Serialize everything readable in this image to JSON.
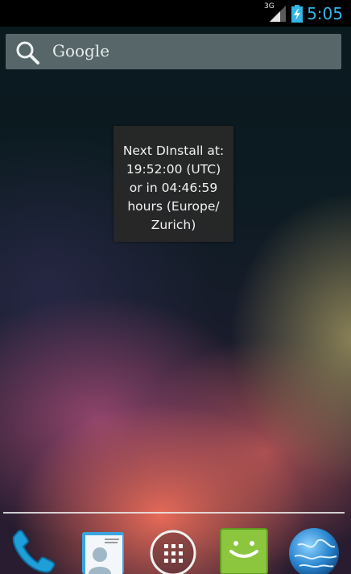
{
  "status_bar": {
    "network_type": "3G",
    "clock": "5:05",
    "icons": [
      "signal-icon",
      "battery-charging-icon"
    ],
    "accent_color": "#33b5e5"
  },
  "search": {
    "label": "Google",
    "icon": "search-icon"
  },
  "widget": {
    "text": "Next DInstall at: 19:52:00 (UTC) or in 04:46:59 hours (Europe/ Zurich)",
    "lines": [
      "Next DInstall at:",
      "19:52:00 (UTC)",
      "or in 04:46:59",
      "hours (Europe/",
      "Zurich)"
    ]
  },
  "dock": {
    "items": [
      {
        "icon": "phone-icon"
      },
      {
        "icon": "contacts-icon"
      },
      {
        "icon": "all-apps-icon"
      },
      {
        "icon": "messaging-icon"
      },
      {
        "icon": "browser-icon"
      }
    ]
  }
}
